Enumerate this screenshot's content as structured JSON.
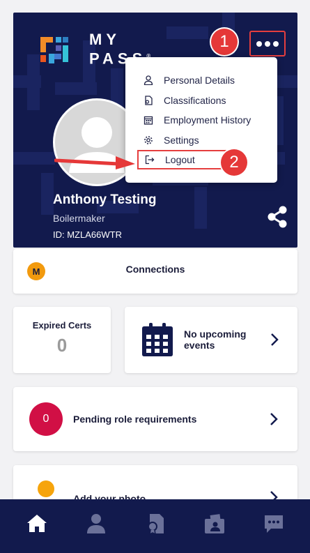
{
  "brand": {
    "name_line1": "MY",
    "name_line2": "PASS",
    "trademark": "®"
  },
  "profile": {
    "name": "Anthony Testing",
    "role": "Boilermaker",
    "id": "ID: MZLA66WTR"
  },
  "annotations": {
    "step1": "1",
    "step2": "2",
    "accent_color": "#e53838"
  },
  "menu": {
    "items": [
      {
        "label": "Personal Details",
        "icon": "person-icon"
      },
      {
        "label": "Classifications",
        "icon": "certificate-icon"
      },
      {
        "label": "Employment History",
        "icon": "calendar-icon"
      },
      {
        "label": "Settings",
        "icon": "gear-icon"
      },
      {
        "label": "Logout",
        "icon": "logout-icon"
      }
    ]
  },
  "connections": {
    "badge": "M",
    "label": "Connections"
  },
  "expired_certs": {
    "label": "Expired Certs",
    "count": "0"
  },
  "events": {
    "label": "No upcoming events",
    "icon": "calendar-icon"
  },
  "pending": {
    "count": "0",
    "label": "Pending role requirements"
  },
  "photo": {
    "label": "Add your photo"
  },
  "bottom_nav": [
    {
      "name": "home",
      "icon": "home-icon",
      "active": true
    },
    {
      "name": "profile",
      "icon": "person-icon",
      "active": false
    },
    {
      "name": "certifications",
      "icon": "document-badge-icon",
      "active": false
    },
    {
      "name": "wallet",
      "icon": "wallet-icon",
      "active": false
    },
    {
      "name": "messages",
      "icon": "chat-icon",
      "active": false
    }
  ],
  "colors": {
    "navy": "#121a4d",
    "pending_red": "#d10f45",
    "orange": "#f29a0e",
    "highlight_red": "#e53e3e"
  }
}
